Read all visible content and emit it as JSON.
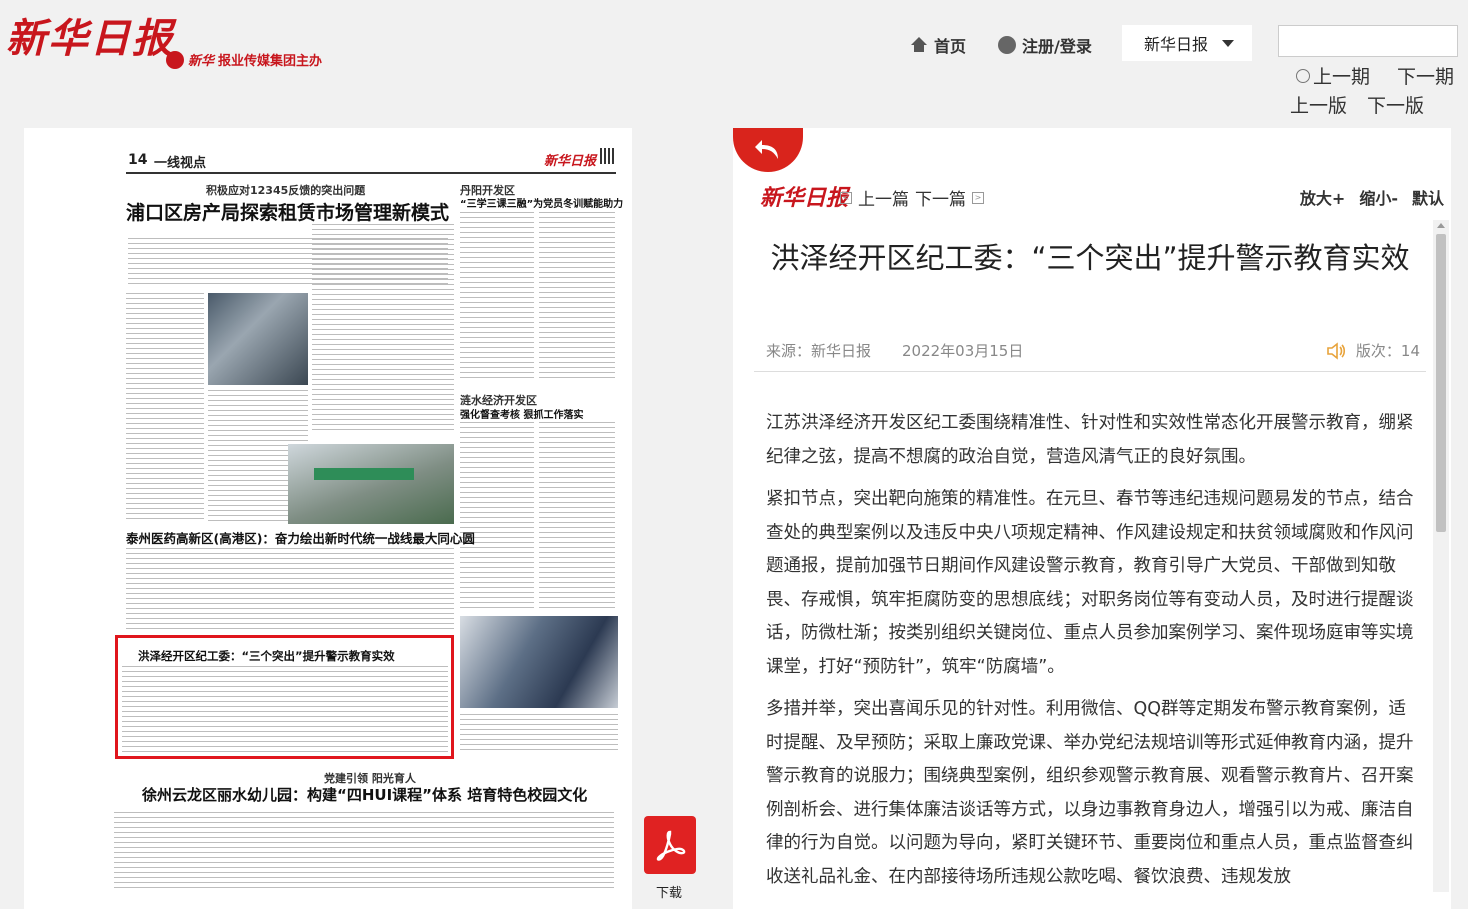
{
  "header": {
    "logo": "新华日报",
    "sponsor": "报业传媒集团主办",
    "sponsor_brand": "新华",
    "home": "首页",
    "login": "注册/登录",
    "select_value": "新华日报",
    "search_placeholder": "",
    "prev_issue": "上一期",
    "next_issue": "下一期",
    "prev_page": "上一版",
    "next_page": "下一版"
  },
  "paper": {
    "page_num": "14",
    "section": "一线视点",
    "brand": "新华日报",
    "lead_kicker": "积极应对12345反馈的突出问题",
    "lead_headline": "浦口区房产局探索租赁市场管理新模式",
    "right_kicker": "丹阳开发区",
    "right_headline": "“三学三课三融”为党员冬训赋能助力",
    "mid_kicker": "涟水经济开发区",
    "mid_headline": "强化督查考核 狠抓工作落实",
    "taizhou_headline": "泰州医药高新区(高港区)：奋力绘出新时代统一战线最大同心圆",
    "highlight_headline": "洪泽经开区纪工委：“三个突出”提升警示教育实效",
    "bottom_kicker": "党建引领 阳光育人",
    "bottom_headline": "徐州云龙区丽水幼儿园：构建“四HUI课程”体系 培育特色校园文化"
  },
  "pdf": {
    "label": "下载"
  },
  "article": {
    "logo": "新华日报",
    "prev": "上一篇",
    "next": "下一篇",
    "zoom_in": "放大+",
    "zoom_out": "缩小-",
    "zoom_default": "默认",
    "title": "洪泽经开区纪工委：“三个突出”提升警示教育实效",
    "source": "来源：新华日报",
    "date": "2022年03月15日",
    "version": "版次：14",
    "paragraphs": [
      "江苏洪泽经济开发区纪工委围绕精准性、针对性和实效性常态化开展警示教育，绷紧纪律之弦，提高不想腐的政治自觉，营造风清气正的良好氛围。",
      "紧扣节点，突出靶向施策的精准性。在元旦、春节等违纪违规问题易发的节点，结合查处的典型案例以及违反中央八项规定精神、作风建设规定和扶贫领域腐败和作风问题通报，提前加强节日期间作风建设警示教育，教育引导广大党员、干部做到知敬畏、存戒惧，筑牢拒腐防变的思想底线；对职务岗位等有变动人员，及时进行提醒谈话，防微杜渐；按类别组织关键岗位、重点人员参加案例学习、案件现场庭审等实境课堂，打好“预防针”，筑牢“防腐墙”。",
      "多措并举，突出喜闻乐见的针对性。利用微信、QQ群等定期发布警示教育案例，适时提醒、及早预防；采取上廉政党课、举办党纪法规培训等形式延伸教育内涵，提升警示教育的说服力；围绕典型案例，组织参观警示教育展、观看警示教育片、召开案例剖析会、进行集体廉洁谈话等方式，以身边事教育身边人，增强引以为戒、廉洁自律的行为自觉。以问题为导向，紧盯关键环节、重要岗位和重点人员，重点监督查纠收送礼品礼金、在内部接待场所违规公款吃喝、餐饮浪费、违规发放"
    ]
  },
  "colors": {
    "brand_red": "#c8161d",
    "highlight_red": "#e0161d"
  }
}
